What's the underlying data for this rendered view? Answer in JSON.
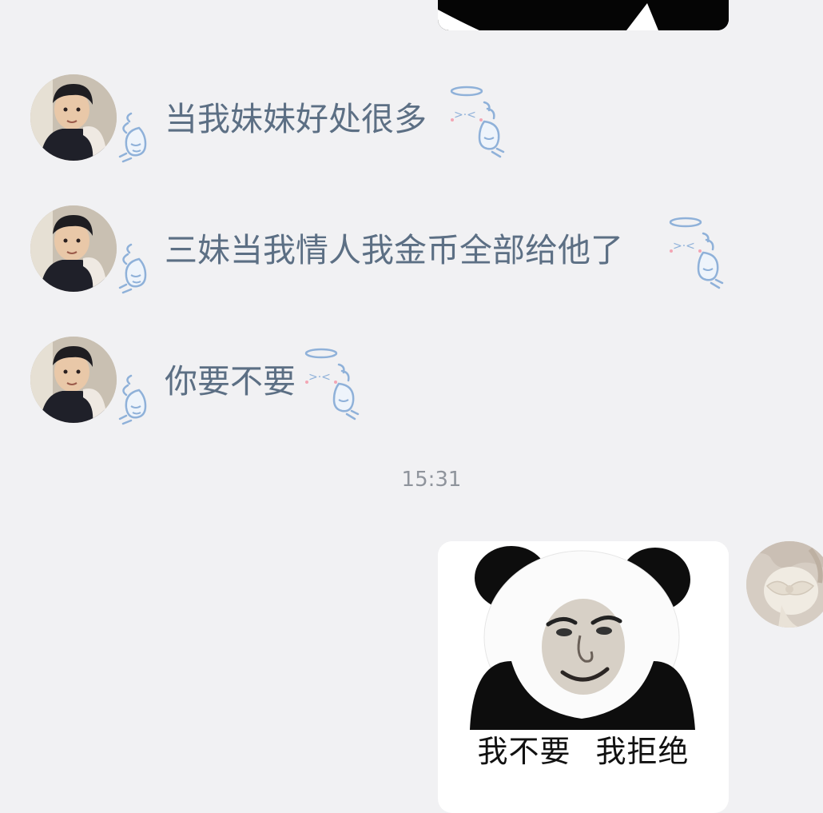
{
  "chat": {
    "messages": [
      {
        "sender": "contact",
        "text": "当我妹妹好处很多"
      },
      {
        "sender": "contact",
        "text": "三妹当我情人我金币全部给他了"
      },
      {
        "sender": "contact",
        "text": "你要不要"
      }
    ],
    "timestamp": "15:31",
    "outgoing_sticker": {
      "caption": "我不要 我拒绝"
    }
  },
  "icons": {
    "contact_avatar": "boy-avatar-photo",
    "my_avatar": "self-avatar-photo",
    "wing_left": "angel-wing-icon",
    "halo_wing_right": "angel-halo-wing-icon",
    "panda_sticker": "panda-meme-sticker"
  },
  "colors": {
    "background": "#f1f1f3",
    "message_text": "#5c6f84",
    "timestamp_text": "#8f949c",
    "decoration_blue": "#8fb1d9"
  }
}
